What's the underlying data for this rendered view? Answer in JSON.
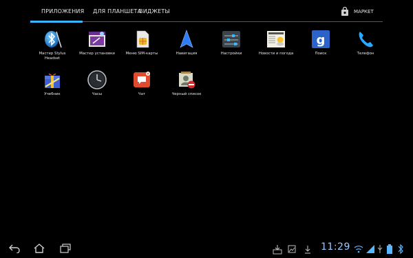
{
  "tabs": [
    {
      "label": "ПРИЛОЖЕНИЯ"
    },
    {
      "label": "ДЛЯ ПЛАНШЕТА"
    },
    {
      "label": "ВИДЖЕТЫ"
    }
  ],
  "market_label": "МАРКЕТ",
  "apps": [
    {
      "label": "Мастер Stylus Headset",
      "icon": "bluetooth-stylus-icon"
    },
    {
      "label": "Мастер установки",
      "icon": "setup-wizard-icon"
    },
    {
      "label": "Меню SIM-карты",
      "icon": "sim-card-icon"
    },
    {
      "label": "Навигация",
      "icon": "navigation-arrow-icon"
    },
    {
      "label": "Настройки",
      "icon": "settings-sliders-icon"
    },
    {
      "label": "Новости и погода",
      "icon": "news-weather-icon"
    },
    {
      "label": "Поиск",
      "icon": "google-search-icon"
    },
    {
      "label": "Телефон",
      "icon": "phone-handset-icon"
    },
    {
      "label": "Учебник",
      "icon": "tutorial-gift-icon"
    },
    {
      "label": "Часы",
      "icon": "clock-icon"
    },
    {
      "label": "Чат",
      "icon": "chat-bubble-icon"
    },
    {
      "label": "Черный список",
      "icon": "blacklist-icon"
    }
  ],
  "status": {
    "time": "11:29"
  },
  "colors": {
    "accent": "#38b6ff",
    "background": "#000000",
    "clock": "#9cc9ff"
  }
}
